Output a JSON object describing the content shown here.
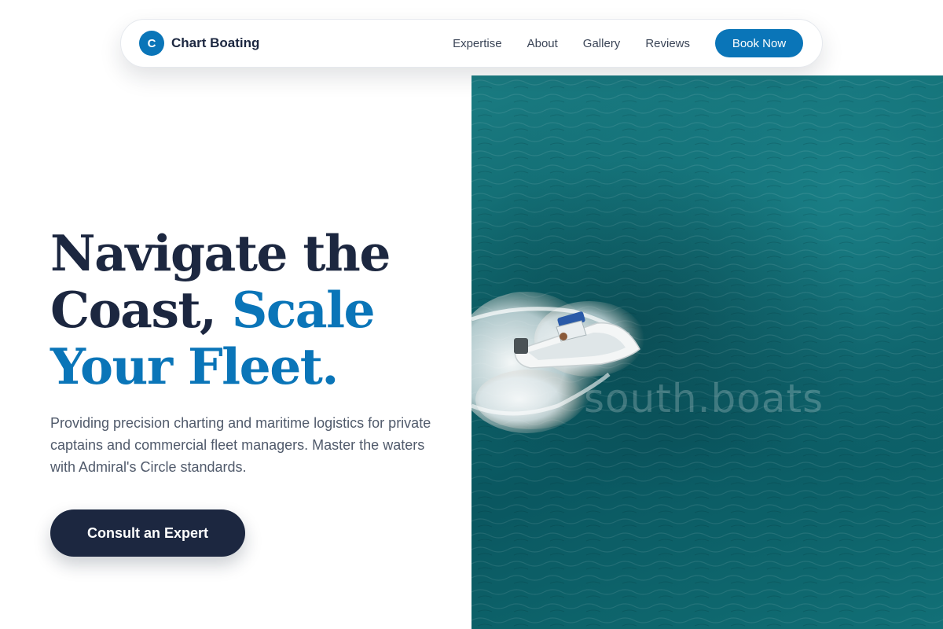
{
  "brand": {
    "logo_letter": "C",
    "name": "Chart Boating",
    "color": "#0a75b8"
  },
  "nav": {
    "links": [
      "Expertise",
      "About",
      "Gallery",
      "Reviews"
    ],
    "cta_label": "Book Now"
  },
  "hero": {
    "title_line1": "Navigate the",
    "title_line2_prefix": "Coast, ",
    "title_line2_accent": "Scale",
    "title_line3_accent": "Your Fleet.",
    "subtitle": "Providing precision charting and maritime logistics for private captains and commercial fleet managers. Master the waters with Admiral's Circle standards.",
    "cta_label": "Consult an Expert",
    "image_watermark": "south.boats"
  },
  "colors": {
    "navy": "#1c2740",
    "accent": "#0a75b8",
    "sea": "#0d6269"
  }
}
